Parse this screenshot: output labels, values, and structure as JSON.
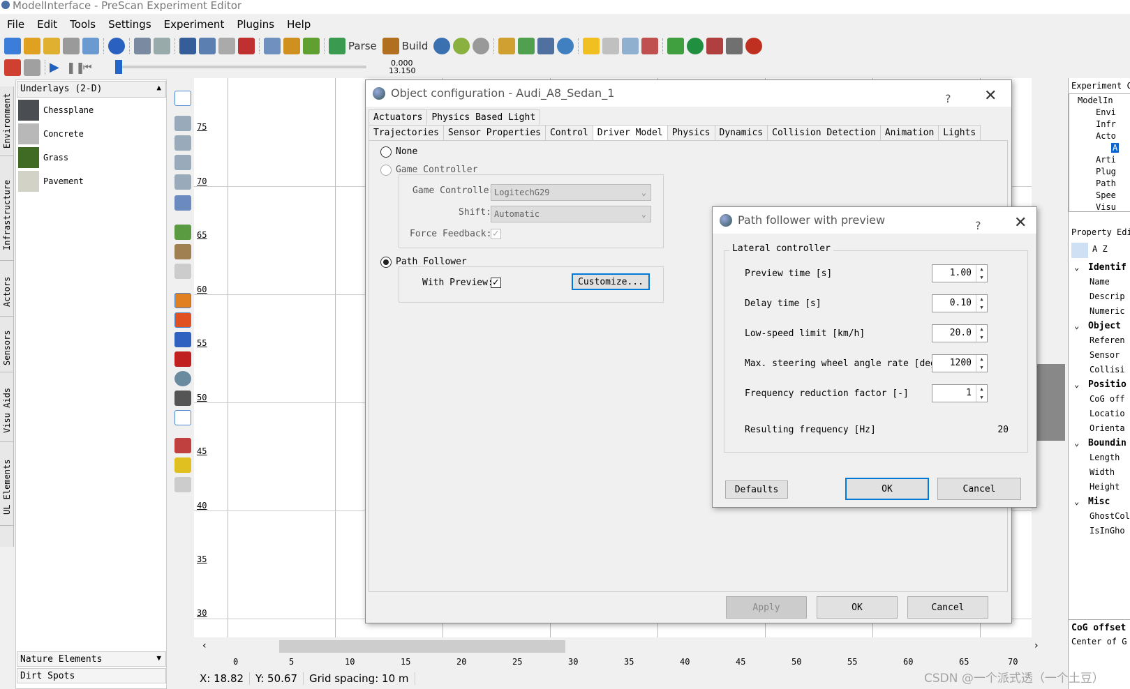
{
  "window": {
    "title": "ModelInterface - PreScan Experiment Editor"
  },
  "menu": [
    "File",
    "Edit",
    "Tools",
    "Settings",
    "Experiment",
    "Plugins",
    "Help"
  ],
  "toolbar": {
    "parse_label": "Parse",
    "build_label": "Build"
  },
  "timeline": {
    "time_top": "0.000",
    "time_bottom": "13.150"
  },
  "left_tabs": [
    "Environment",
    "Infrastructure",
    "Actors",
    "Sensors",
    "Visu Aids",
    "UL Elements"
  ],
  "library": {
    "header": "Underlays (2-D)",
    "items": [
      {
        "label": "Chessplane",
        "color": "#4a4e52"
      },
      {
        "label": "Concrete",
        "color": "#b8b8b8"
      },
      {
        "label": "Grass",
        "color": "#3f6b25"
      },
      {
        "label": "Pavement",
        "color": "#d2d2c6"
      }
    ],
    "footer1": "Nature Elements",
    "footer2": "Dirt Spots"
  },
  "ruler_v": [
    "75",
    "70",
    "65",
    "60",
    "55",
    "50",
    "45",
    "40",
    "35",
    "30"
  ],
  "ruler_h": [
    "0",
    "5",
    "10",
    "15",
    "20",
    "25",
    "30",
    "35",
    "40",
    "45",
    "50",
    "55",
    "60",
    "65",
    "70"
  ],
  "status": {
    "x": "X: 18.82",
    "y": "Y: 50.67",
    "grid": "Grid spacing: 10 m"
  },
  "right_panel": {
    "title": "Experiment C",
    "tree": [
      "ModelIn",
      "Envi",
      "Infr",
      "Acto",
      "A",
      "Arti",
      "Plug",
      "Path",
      "Spee",
      "Visu"
    ],
    "prop_title": "Property Edi",
    "sort_label": "A Z",
    "props": [
      {
        "t": "Identif",
        "b": true
      },
      {
        "t": "Name"
      },
      {
        "t": "Descrip"
      },
      {
        "t": "Numeric"
      },
      {
        "t": "Object",
        "b": true
      },
      {
        "t": "Referen"
      },
      {
        "t": "Sensor"
      },
      {
        "t": "Collisi"
      },
      {
        "t": "Positio",
        "b": true
      },
      {
        "t": "CoG off"
      },
      {
        "t": "Locatio"
      },
      {
        "t": "Orienta"
      },
      {
        "t": "Boundin",
        "b": true
      },
      {
        "t": "Length"
      },
      {
        "t": "Width"
      },
      {
        "t": "Height"
      },
      {
        "t": "Misc",
        "b": true
      },
      {
        "t": "GhostCol"
      },
      {
        "t": "IsInGho"
      }
    ],
    "footer_title": "CoG offset",
    "footer_text": "Center of G"
  },
  "obj_dialog": {
    "title": "Object configuration - Audi_A8_Sedan_1",
    "help": "?",
    "tabs_row1": [
      "Actuators",
      "Physics Based Light"
    ],
    "tabs_row2": [
      "Trajectories",
      "Sensor Properties",
      "Control",
      "Driver Model",
      "Physics",
      "Dynamics",
      "Collision Detection",
      "Animation",
      "Lights"
    ],
    "active_tab": "Driver Model",
    "none_label": "None",
    "game_controller_label": "Game Controller",
    "gc_field_label": "Game Controller",
    "gc_value": "LogitechG29",
    "shift_label": "Shift:",
    "shift_value": "Automatic",
    "force_label": "Force Feedback:",
    "path_follower_label": "Path Follower",
    "with_preview_label": "With Preview:",
    "customize_label": "Customize...",
    "apply": "Apply",
    "ok": "OK",
    "cancel": "Cancel"
  },
  "pf_dialog": {
    "title": "Path follower with preview",
    "help": "?",
    "group": "Lateral controller",
    "fields": [
      {
        "label": "Preview time [s]",
        "value": "1.00"
      },
      {
        "label": "Delay time [s]",
        "value": "0.10"
      },
      {
        "label": "Low-speed limit [km/h]",
        "value": "20.0"
      },
      {
        "label": "Max. steering wheel angle rate [deg/s]",
        "value": "1200"
      },
      {
        "label": "Frequency reduction factor [-]",
        "value": "1"
      }
    ],
    "result_label": "Resulting frequency [Hz]",
    "result_value": "20",
    "defaults": "Defaults",
    "ok": "OK",
    "cancel": "Cancel"
  },
  "watermark": "CSDN @一个派式透（一个土豆）"
}
